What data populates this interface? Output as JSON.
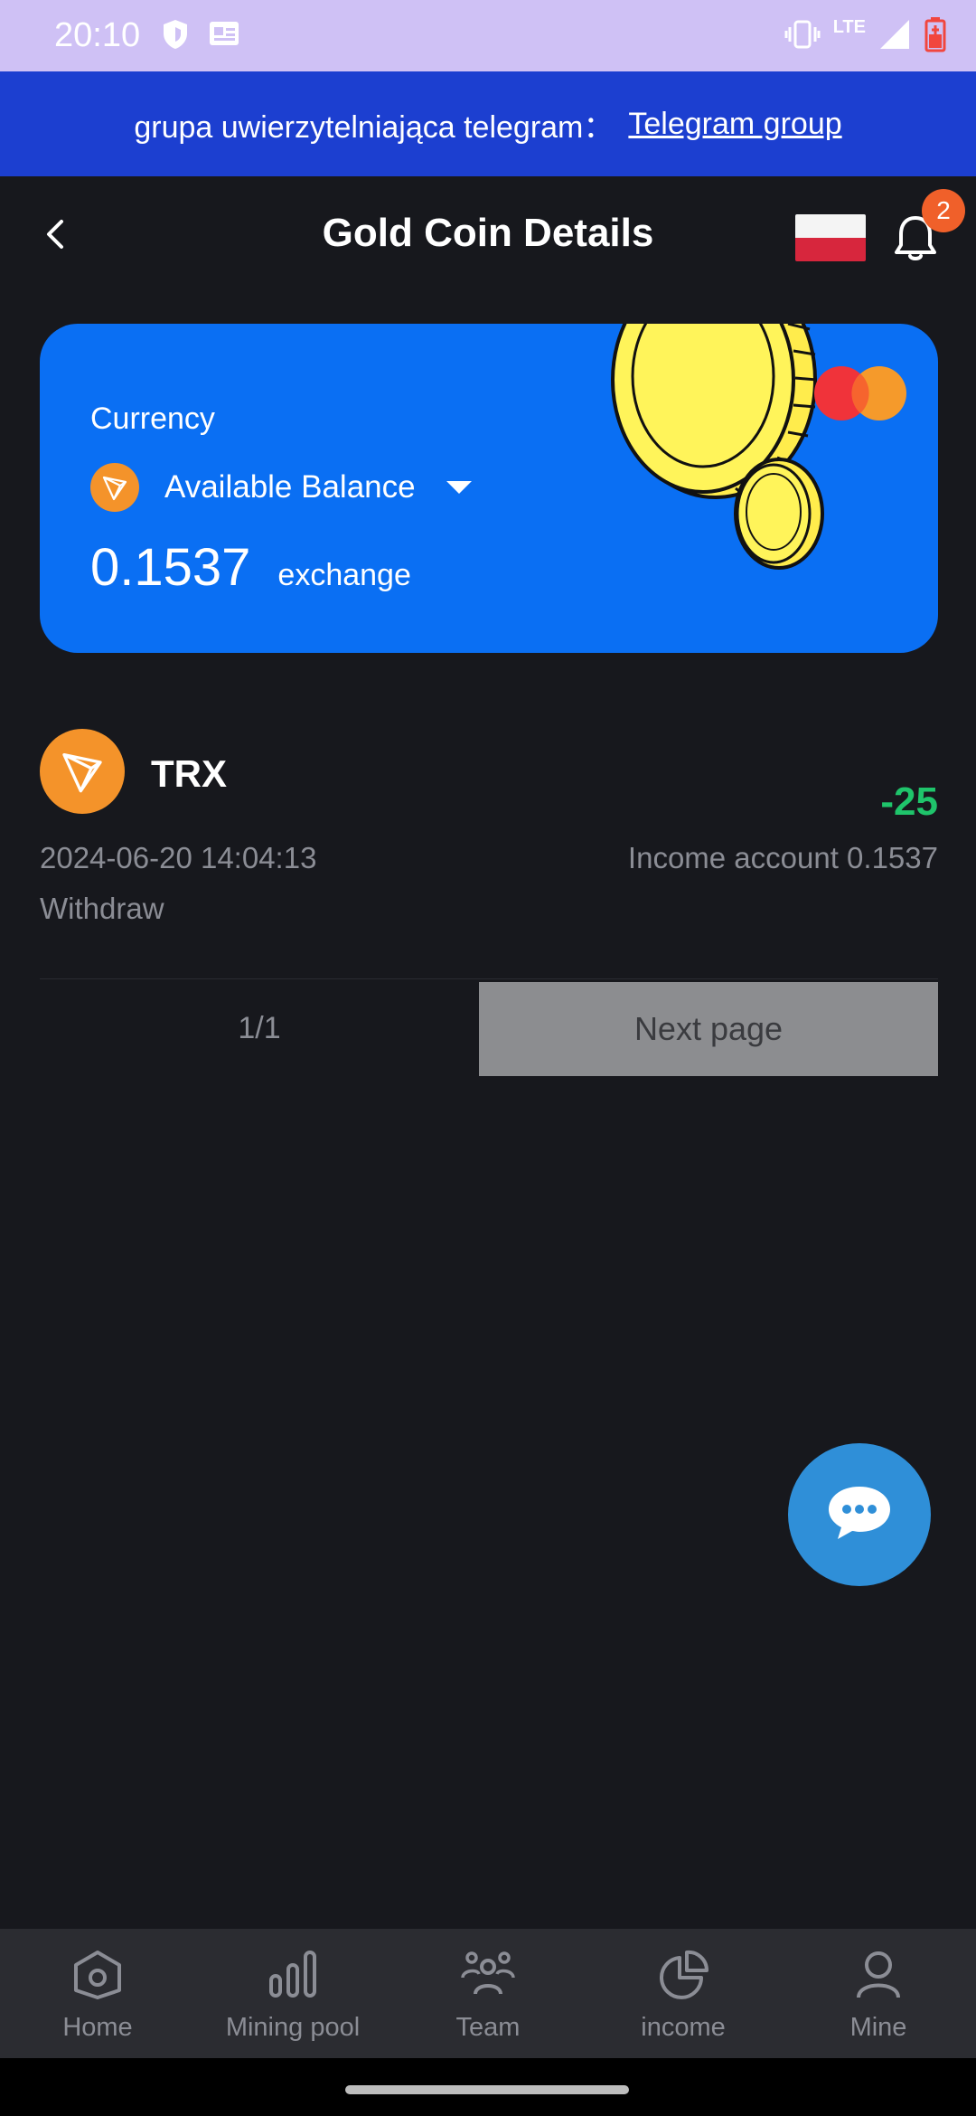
{
  "status_bar": {
    "time": "20:10",
    "network": "LTE",
    "icons": [
      "shield-icon",
      "sim-card-icon",
      "vibrate-icon",
      "signal-icon",
      "battery-icon"
    ]
  },
  "banner": {
    "text": "grupa uwierzytelniająca telegram：",
    "link": "Telegram group"
  },
  "header": {
    "title": "Gold Coin Details",
    "notification_count": "2"
  },
  "card": {
    "currency_label": "Currency",
    "coin_select": "Available Balance",
    "balance": "0.1537",
    "exchange": "exchange",
    "accent": "#0a6ff3"
  },
  "transactions": [
    {
      "coin": "TRX",
      "amount": "-25",
      "date": "2024-06-20 14:04:13",
      "account": "Income account 0.1537",
      "type": "Withdraw",
      "amount_color": "#1fc46b"
    }
  ],
  "pagination": {
    "info": "1/1",
    "next": "Next page"
  },
  "bottom_nav": [
    {
      "label": "Home",
      "icon": "home-icon"
    },
    {
      "label": "Mining pool",
      "icon": "bar-chart-icon"
    },
    {
      "label": "Team",
      "icon": "team-icon"
    },
    {
      "label": "income",
      "icon": "pie-chart-icon"
    },
    {
      "label": "Mine",
      "icon": "user-icon"
    }
  ]
}
